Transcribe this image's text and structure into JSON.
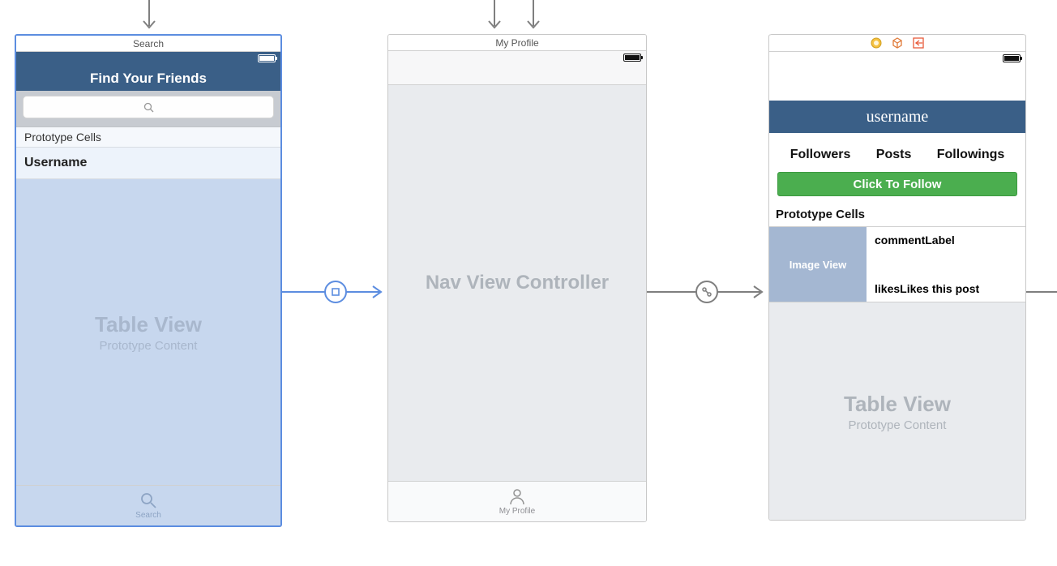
{
  "vc1": {
    "title": "Search",
    "navTitle": "Find Your Friends",
    "protoHeader": "Prototype Cells",
    "cellLabel": "Username",
    "placeholderBig": "Table View",
    "placeholderSub": "Prototype Content",
    "tabLabel": "Search"
  },
  "vc2": {
    "title": "My Profile",
    "centerText": "Nav View Controller",
    "tabLabel": "My Profile"
  },
  "vc3": {
    "usernameTitle": "username",
    "stats": {
      "followers": "Followers",
      "posts": "Posts",
      "followings": "Followings"
    },
    "followBtn": "Click To Follow",
    "protoHeader": "Prototype Cells",
    "imageView": "Image View",
    "commentLabel": "commentLabel",
    "likesLabelA": "likes",
    "likesLabelB": "Likes this post",
    "placeholderBig": "Table View",
    "placeholderSub": "Prototype Content"
  }
}
